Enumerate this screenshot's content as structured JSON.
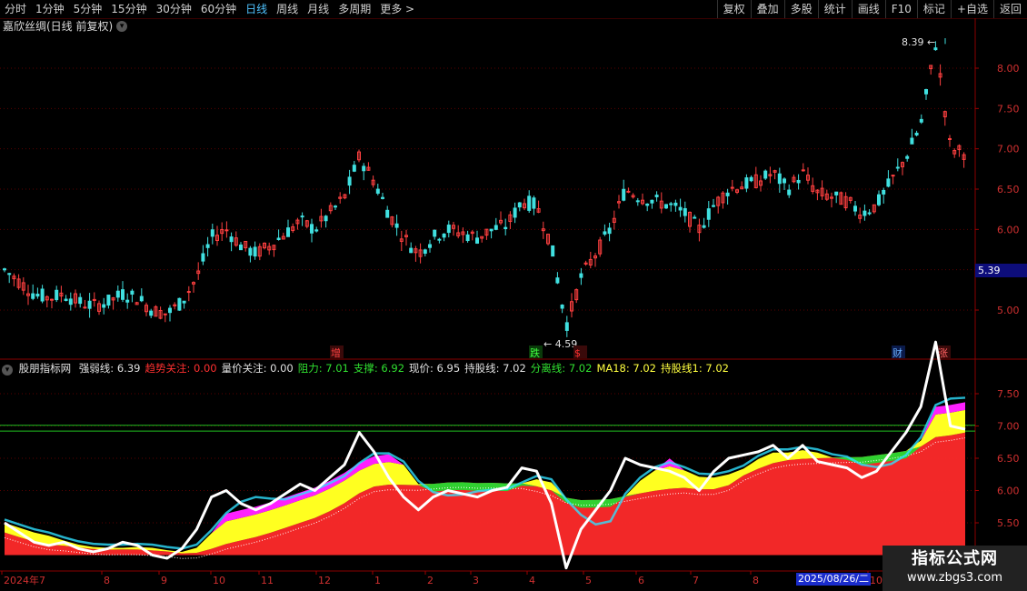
{
  "toolbar": {
    "tabs": [
      {
        "label": "分时",
        "active": false
      },
      {
        "label": "1分钟",
        "active": false
      },
      {
        "label": "5分钟",
        "active": false
      },
      {
        "label": "15分钟",
        "active": false
      },
      {
        "label": "30分钟",
        "active": false
      },
      {
        "label": "60分钟",
        "active": false
      },
      {
        "label": "日线",
        "active": true
      },
      {
        "label": "周线",
        "active": false
      },
      {
        "label": "月线",
        "active": false
      },
      {
        "label": "多周期",
        "active": false
      },
      {
        "label": "更多 >",
        "active": false
      }
    ],
    "right_buttons": [
      "复权",
      "叠加",
      "多股",
      "统计",
      "画线",
      "F10",
      "标记",
      "+自选",
      "返回"
    ]
  },
  "main_chart": {
    "title": "嘉欣丝绸(日线 前复权)",
    "high_label": "8.39",
    "low_label": "4.59",
    "current_price": "5.39",
    "y_ticks": [
      "8.00",
      "7.50",
      "7.00",
      "6.50",
      "6.00",
      "5.50",
      "5.00"
    ],
    "markers": [
      {
        "text": "增",
        "color": "#ff4040"
      },
      {
        "text": "跌",
        "color": "#40ff40"
      },
      {
        "text": "$",
        "color": "#ff3030"
      },
      {
        "text": "财",
        "color": "#6ab0ff"
      },
      {
        "text": "涨",
        "color": "#ff6060"
      }
    ]
  },
  "indicator": {
    "name": "股朋指标网",
    "values": [
      {
        "text": "强弱线: 6.39",
        "color": "#e0e0e0"
      },
      {
        "text": "趋势关注: 0.00",
        "color": "#ff3030"
      },
      {
        "text": "量价关注: 0.00",
        "color": "#e0e0e0"
      },
      {
        "text": "阻力: 7.01",
        "color": "#30e030"
      },
      {
        "text": "支撑: 6.92",
        "color": "#30e030"
      },
      {
        "text": "现价: 6.95",
        "color": "#e0e0e0"
      },
      {
        "text": "持股线: 7.02",
        "color": "#e0e0e0"
      },
      {
        "text": "分离线: 7.02",
        "color": "#30e030"
      },
      {
        "text": "MA18: 7.02",
        "color": "#ffff40"
      },
      {
        "text": "持股线1: 7.02",
        "color": "#ffff40"
      }
    ],
    "y_ticks": [
      "7.50",
      "7.00",
      "6.50",
      "6.00",
      "5.50"
    ]
  },
  "x_axis": {
    "labels": [
      "2024年7",
      "8",
      "9",
      "10",
      "11",
      "12",
      "1",
      "2",
      "3",
      "4",
      "5",
      "6",
      "7",
      "8",
      "10"
    ],
    "cursor_date": "2025/08/26/二"
  },
  "watermark": {
    "line1": "指标公式网",
    "line2": "www.zbgs3.com"
  },
  "chart_data": {
    "type": "line",
    "note_series": "daily closing price approximation",
    "series": [
      {
        "name": "现价",
        "values": [
          5.5,
          5.35,
          5.2,
          5.15,
          5.2,
          5.1,
          5.05,
          5.1,
          5.2,
          5.15,
          5.0,
          4.95,
          5.1,
          5.4,
          5.9,
          6.0,
          5.8,
          5.7,
          5.8,
          5.95,
          6.1,
          6.0,
          6.2,
          6.4,
          6.9,
          6.6,
          6.2,
          5.9,
          5.7,
          5.9,
          6.0,
          5.95,
          5.9,
          6.0,
          6.05,
          6.35,
          6.3,
          5.8,
          4.8,
          5.4,
          5.7,
          6.0,
          6.5,
          6.4,
          6.35,
          6.3,
          6.2,
          6.0,
          6.3,
          6.5,
          6.55,
          6.6,
          6.7,
          6.5,
          6.7,
          6.45,
          6.4,
          6.35,
          6.2,
          6.3,
          6.6,
          6.9,
          7.3,
          8.3,
          7.0,
          6.95
        ]
      }
    ]
  }
}
